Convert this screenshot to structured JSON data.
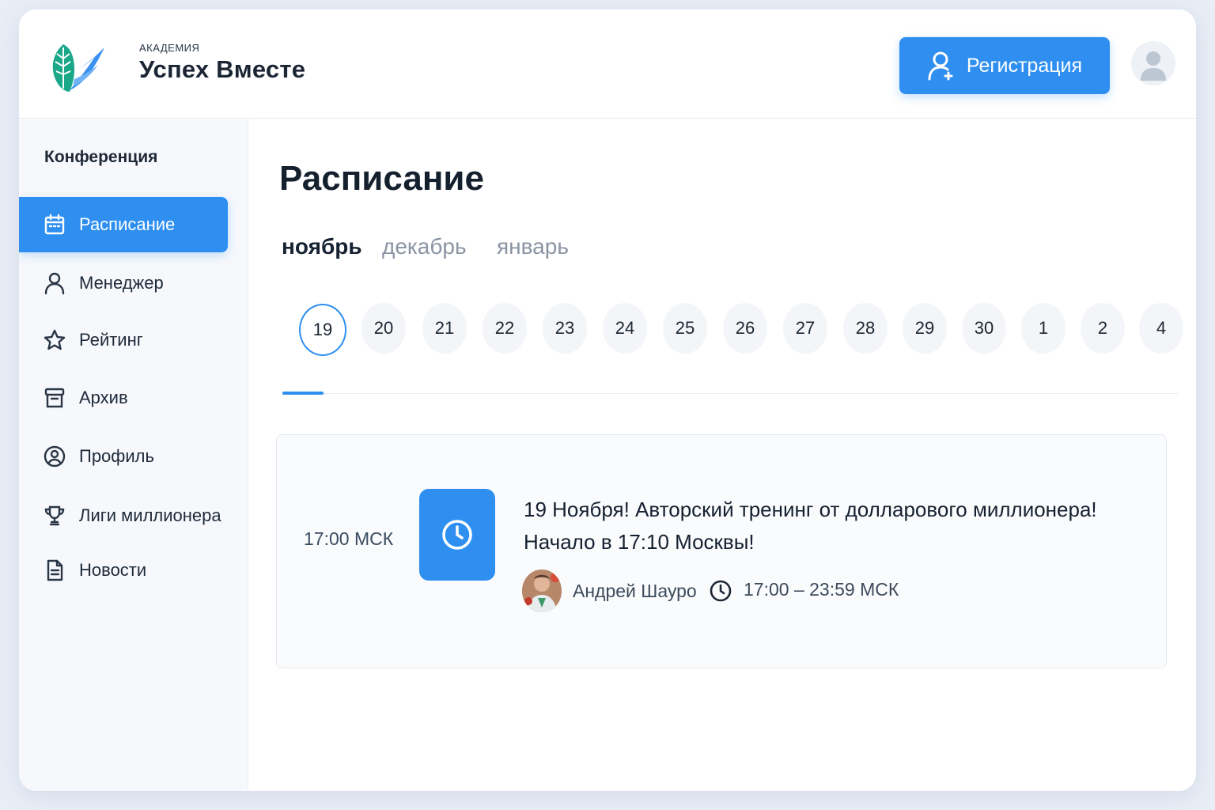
{
  "header": {
    "logo_small": "АКАДЕМИЯ",
    "logo_title": "Успех Вместе",
    "register_label": "Регистрация",
    "icons": {
      "register": "user-icon",
      "avatar": "user-avatar-icon"
    }
  },
  "sidebar": {
    "section_title": "Конференция",
    "items": [
      {
        "label": "Расписание",
        "icon": "calendar-icon",
        "active": true
      },
      {
        "label": "Менеджер",
        "icon": "user-icon",
        "active": false
      },
      {
        "label": "Рейтинг",
        "icon": "star-icon",
        "active": false
      },
      {
        "label": "Архив",
        "icon": "archive-icon",
        "active": false
      },
      {
        "label": "Профиль",
        "icon": "profile-circle-icon",
        "active": false
      },
      {
        "label": "Лиги миллионера",
        "icon": "trophy-icon",
        "active": false
      },
      {
        "label": "Новости",
        "icon": "document-icon",
        "active": false
      }
    ]
  },
  "main": {
    "title": "Расписание",
    "months": [
      {
        "label": "ноябрь",
        "active": true
      },
      {
        "label": "декабрь",
        "active": false
      },
      {
        "label": "январь",
        "active": false
      }
    ],
    "days": [
      {
        "label": "19",
        "active": true
      },
      {
        "label": "20",
        "active": false
      },
      {
        "label": "21",
        "active": false
      },
      {
        "label": "22",
        "active": false
      },
      {
        "label": "23",
        "active": false
      },
      {
        "label": "24",
        "active": false
      },
      {
        "label": "25",
        "active": false
      },
      {
        "label": "26",
        "active": false
      },
      {
        "label": "27",
        "active": false
      },
      {
        "label": "28",
        "active": false
      },
      {
        "label": "29",
        "active": false
      },
      {
        "label": "30",
        "active": false
      },
      {
        "label": "1",
        "active": false
      },
      {
        "label": "2",
        "active": false
      },
      {
        "label": "4",
        "active": false
      }
    ],
    "event": {
      "time": "17:00 МСК",
      "icon": "clock-icon",
      "title_line1": "19 Ноября! Авторский тренинг от долларового миллионера!",
      "title_line2": "Начало в 17:10 Москвы!",
      "speaker": "Андрей Шауро",
      "time_range": "17:00 – 23:59 МСК"
    }
  },
  "colors": {
    "accent": "#2e8ff0",
    "text_dark": "#15202e",
    "text_muted": "#8a94a3",
    "sidebar_bg": "#f6f8fc",
    "logo_teal": "#1aa889"
  }
}
